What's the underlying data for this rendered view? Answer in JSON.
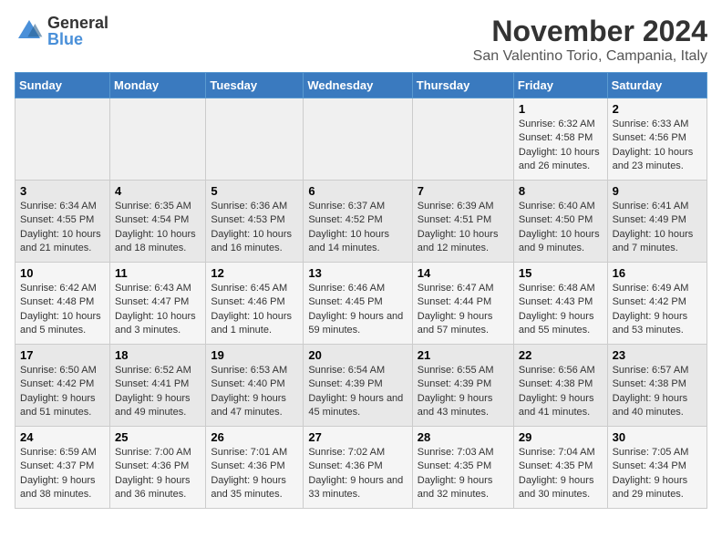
{
  "header": {
    "logo_general": "General",
    "logo_blue": "Blue",
    "month_title": "November 2024",
    "location": "San Valentino Torio, Campania, Italy"
  },
  "weekdays": [
    "Sunday",
    "Monday",
    "Tuesday",
    "Wednesday",
    "Thursday",
    "Friday",
    "Saturday"
  ],
  "weeks": [
    [
      {
        "day": "",
        "info": ""
      },
      {
        "day": "",
        "info": ""
      },
      {
        "day": "",
        "info": ""
      },
      {
        "day": "",
        "info": ""
      },
      {
        "day": "",
        "info": ""
      },
      {
        "day": "1",
        "info": "Sunrise: 6:32 AM\nSunset: 4:58 PM\nDaylight: 10 hours and 26 minutes."
      },
      {
        "day": "2",
        "info": "Sunrise: 6:33 AM\nSunset: 4:56 PM\nDaylight: 10 hours and 23 minutes."
      }
    ],
    [
      {
        "day": "3",
        "info": "Sunrise: 6:34 AM\nSunset: 4:55 PM\nDaylight: 10 hours and 21 minutes."
      },
      {
        "day": "4",
        "info": "Sunrise: 6:35 AM\nSunset: 4:54 PM\nDaylight: 10 hours and 18 minutes."
      },
      {
        "day": "5",
        "info": "Sunrise: 6:36 AM\nSunset: 4:53 PM\nDaylight: 10 hours and 16 minutes."
      },
      {
        "day": "6",
        "info": "Sunrise: 6:37 AM\nSunset: 4:52 PM\nDaylight: 10 hours and 14 minutes."
      },
      {
        "day": "7",
        "info": "Sunrise: 6:39 AM\nSunset: 4:51 PM\nDaylight: 10 hours and 12 minutes."
      },
      {
        "day": "8",
        "info": "Sunrise: 6:40 AM\nSunset: 4:50 PM\nDaylight: 10 hours and 9 minutes."
      },
      {
        "day": "9",
        "info": "Sunrise: 6:41 AM\nSunset: 4:49 PM\nDaylight: 10 hours and 7 minutes."
      }
    ],
    [
      {
        "day": "10",
        "info": "Sunrise: 6:42 AM\nSunset: 4:48 PM\nDaylight: 10 hours and 5 minutes."
      },
      {
        "day": "11",
        "info": "Sunrise: 6:43 AM\nSunset: 4:47 PM\nDaylight: 10 hours and 3 minutes."
      },
      {
        "day": "12",
        "info": "Sunrise: 6:45 AM\nSunset: 4:46 PM\nDaylight: 10 hours and 1 minute."
      },
      {
        "day": "13",
        "info": "Sunrise: 6:46 AM\nSunset: 4:45 PM\nDaylight: 9 hours and 59 minutes."
      },
      {
        "day": "14",
        "info": "Sunrise: 6:47 AM\nSunset: 4:44 PM\nDaylight: 9 hours and 57 minutes."
      },
      {
        "day": "15",
        "info": "Sunrise: 6:48 AM\nSunset: 4:43 PM\nDaylight: 9 hours and 55 minutes."
      },
      {
        "day": "16",
        "info": "Sunrise: 6:49 AM\nSunset: 4:42 PM\nDaylight: 9 hours and 53 minutes."
      }
    ],
    [
      {
        "day": "17",
        "info": "Sunrise: 6:50 AM\nSunset: 4:42 PM\nDaylight: 9 hours and 51 minutes."
      },
      {
        "day": "18",
        "info": "Sunrise: 6:52 AM\nSunset: 4:41 PM\nDaylight: 9 hours and 49 minutes."
      },
      {
        "day": "19",
        "info": "Sunrise: 6:53 AM\nSunset: 4:40 PM\nDaylight: 9 hours and 47 minutes."
      },
      {
        "day": "20",
        "info": "Sunrise: 6:54 AM\nSunset: 4:39 PM\nDaylight: 9 hours and 45 minutes."
      },
      {
        "day": "21",
        "info": "Sunrise: 6:55 AM\nSunset: 4:39 PM\nDaylight: 9 hours and 43 minutes."
      },
      {
        "day": "22",
        "info": "Sunrise: 6:56 AM\nSunset: 4:38 PM\nDaylight: 9 hours and 41 minutes."
      },
      {
        "day": "23",
        "info": "Sunrise: 6:57 AM\nSunset: 4:38 PM\nDaylight: 9 hours and 40 minutes."
      }
    ],
    [
      {
        "day": "24",
        "info": "Sunrise: 6:59 AM\nSunset: 4:37 PM\nDaylight: 9 hours and 38 minutes."
      },
      {
        "day": "25",
        "info": "Sunrise: 7:00 AM\nSunset: 4:36 PM\nDaylight: 9 hours and 36 minutes."
      },
      {
        "day": "26",
        "info": "Sunrise: 7:01 AM\nSunset: 4:36 PM\nDaylight: 9 hours and 35 minutes."
      },
      {
        "day": "27",
        "info": "Sunrise: 7:02 AM\nSunset: 4:36 PM\nDaylight: 9 hours and 33 minutes."
      },
      {
        "day": "28",
        "info": "Sunrise: 7:03 AM\nSunset: 4:35 PM\nDaylight: 9 hours and 32 minutes."
      },
      {
        "day": "29",
        "info": "Sunrise: 7:04 AM\nSunset: 4:35 PM\nDaylight: 9 hours and 30 minutes."
      },
      {
        "day": "30",
        "info": "Sunrise: 7:05 AM\nSunset: 4:34 PM\nDaylight: 9 hours and 29 minutes."
      }
    ]
  ]
}
